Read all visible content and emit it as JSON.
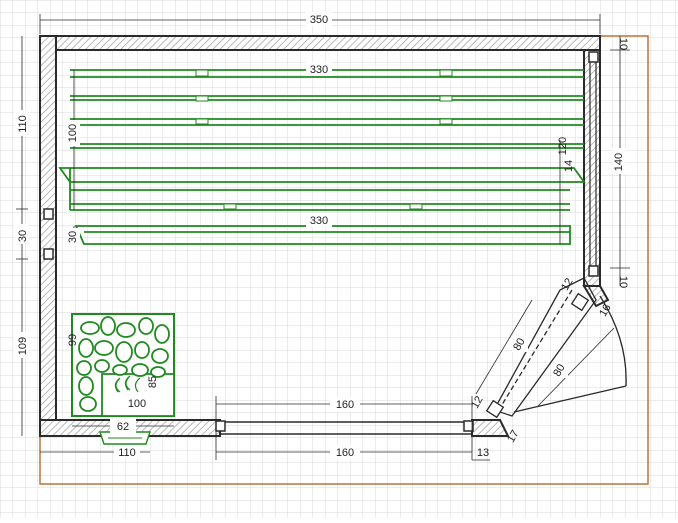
{
  "dimensions": {
    "top_width": "350",
    "right_top": "10",
    "right_wall": "140",
    "right_bottom": "10",
    "left_upper": "110",
    "left_mid": "30",
    "left_lower": "109",
    "bench_length_top": "330",
    "bench_length_lower": "330",
    "bench_depth_top": "100",
    "bench_depth_lower": "30",
    "bench_step": "120",
    "bench_gap": "14",
    "heater_depth": "99",
    "heater_inner_h": "85",
    "heater_inner_w": "100",
    "heater_width": "62",
    "door_offset": "110",
    "window_inner": "160",
    "window_outer": "160",
    "corner_13": "13",
    "corner_12a": "12",
    "corner_12b": "12",
    "corner_16": "16",
    "corner_17": "17",
    "glass_len": "80",
    "door_swing": "80"
  },
  "colors": {
    "wall": "#2a2a2a",
    "hatch": "#9a9a9a",
    "bench": "#1f8a1f",
    "grid": "#d8d8d8",
    "outline": "#b5753a"
  }
}
